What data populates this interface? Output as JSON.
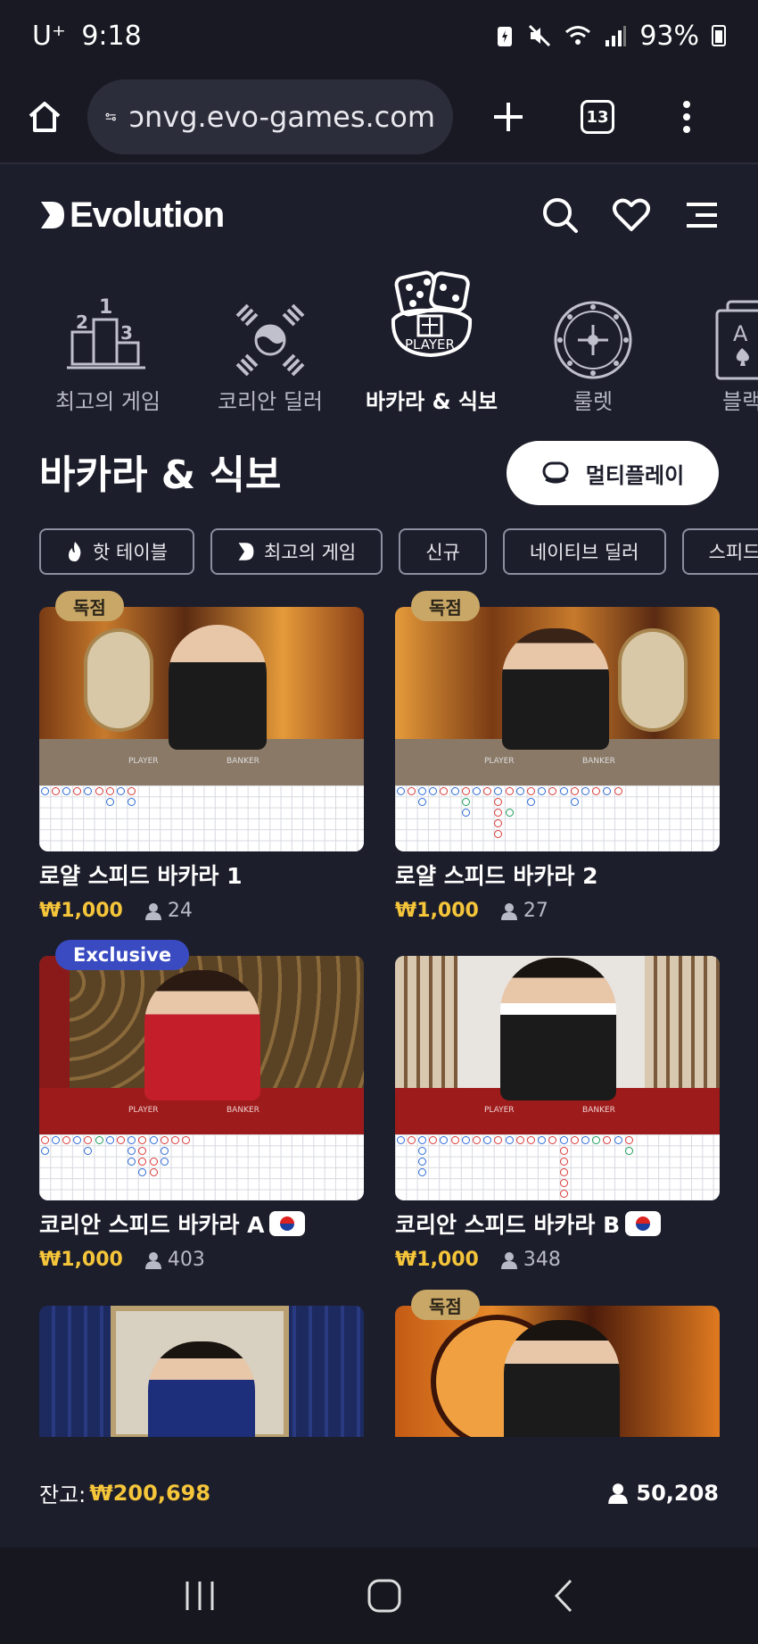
{
  "status_bar": {
    "carrier": "U⁺",
    "time": "9:18",
    "battery": "93%"
  },
  "browser": {
    "url": "ɔnvg.evo-games.com",
    "tab_count": "13"
  },
  "brand": {
    "name": "Evolution"
  },
  "categories": [
    {
      "label": "최고의 게임",
      "icon": "podium-icon"
    },
    {
      "label": "코리안 딜러",
      "icon": "korean-trigram-icon"
    },
    {
      "label": "바카라 & 식보",
      "icon": "dice-player-icon",
      "active": true,
      "icon_text": "PLAYER"
    },
    {
      "label": "룰렛",
      "icon": "roulette-wheel-icon"
    },
    {
      "label": "블랙",
      "icon": "card-ace-icon",
      "icon_text": "A"
    }
  ],
  "section": {
    "title": "바카라 & 식보",
    "multiplay_label": "멀티플레이"
  },
  "chips": [
    {
      "label": "핫 테이블",
      "icon": "fire-icon"
    },
    {
      "label": "최고의 게임",
      "icon": "evolution-mark-icon"
    },
    {
      "label": "신규"
    },
    {
      "label": "네이티브 딜러"
    },
    {
      "label": "스피드"
    }
  ],
  "games": [
    {
      "title": "로얄 스피드 바카라 1",
      "price": "₩1,000",
      "players": "24",
      "badge": "독점"
    },
    {
      "title": "로얄 스피드 바카라 2",
      "price": "₩1,000",
      "players": "27",
      "badge": "독점"
    },
    {
      "title": "코리안 스피드 바카라 A",
      "price": "₩1,000",
      "players": "403",
      "badge": "Exclusive",
      "flag": true
    },
    {
      "title": "코리안 스피드 바카라 B",
      "price": "₩1,000",
      "players": "348",
      "flag": true
    },
    {
      "title": "",
      "price": "",
      "players": ""
    },
    {
      "title": "",
      "price": "",
      "players": "",
      "badge": "독점"
    }
  ],
  "table_print": {
    "player": "PLAYER",
    "banker": "BANKER"
  },
  "footer": {
    "balance_label": "잔고:",
    "balance_value": "₩200,698",
    "total_players": "50,208"
  },
  "colors": {
    "background": "#1d1e2b",
    "accent_gold": "#f5c53a",
    "badge_gold": "#c9a766",
    "exclusive_blue": "#3a4bc2"
  }
}
